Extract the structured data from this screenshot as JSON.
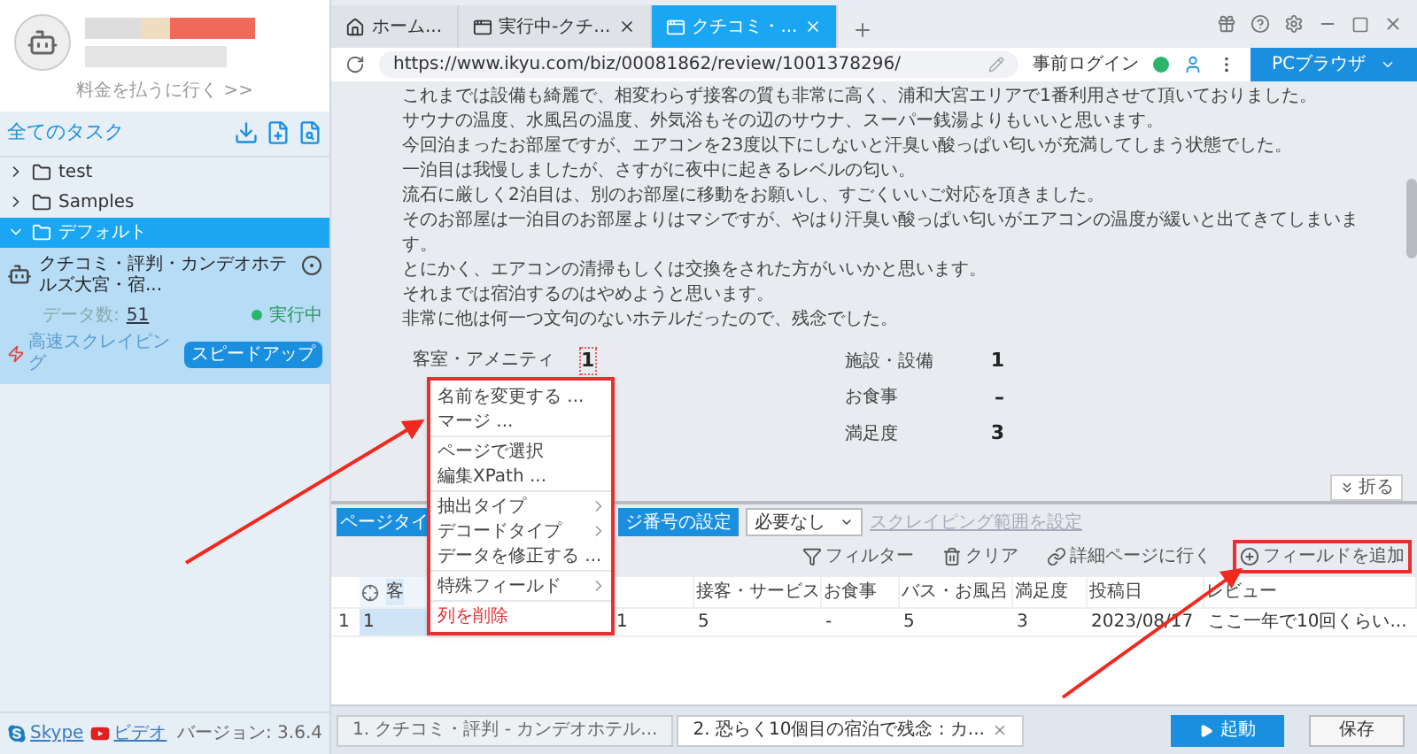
{
  "sidebar": {
    "account_link": "料金を払うに行く >>",
    "section_title": "全てのタスク",
    "folders": [
      {
        "name": "test",
        "expanded": false,
        "selected": false
      },
      {
        "name": "Samples",
        "expanded": false,
        "selected": false
      },
      {
        "name": "デフォルト",
        "expanded": true,
        "selected": true,
        "children": [
          {
            "title": "クチコミ・評判・カンデオホテルズ大宮・宿...",
            "data_label": "データ数:",
            "data_count": "51",
            "status": "実行中",
            "mode": "高速スクレイピング",
            "action": "スピードアップ"
          }
        ]
      }
    ],
    "footer": {
      "links": [
        {
          "label": "Skype",
          "kind": "skype"
        },
        {
          "label": "ビデオ",
          "kind": "video"
        }
      ],
      "version": "バージョン: 3.6.4"
    }
  },
  "browser_tabs": [
    {
      "label": "ホーム...",
      "kind": "home",
      "selected": false,
      "closable": false
    },
    {
      "label": "実行中-クチ...",
      "kind": "page",
      "selected": false,
      "closable": true
    },
    {
      "label": "クチコミ・...",
      "kind": "page",
      "selected": true,
      "closable": true
    }
  ],
  "address_bar": {
    "url": "https://www.ikyu.com/biz/00081862/review/1001378296/",
    "login": "事前ログイン",
    "browser_mode": "PCブラウザ"
  },
  "page": {
    "review_lines": [
      "これまでは設備も綺麗で、相変わらず接客の質も非常に高く、浦和大宮エリアで1番利用させて頂いておりました。",
      "サウナの温度、水風呂の温度、外気浴もその辺のサウナ、スーパー銭湯よりもいいと思います。",
      "今回泊まったお部屋ですが、エアコンを23度以下にしないと汗臭い酸っぱい匂いが充満してしまう状態でした。",
      "一泊目は我慢しましたが、さすがに夜中に起きるレベルの匂い。",
      "流石に厳しく2泊目は、別のお部屋に移動をお願いし、すごくいいご対応を頂きました。",
      "そのお部屋は一泊目のお部屋よりはマシですが、やはり汗臭い酸っぱい匂いがエアコンの温度が緩いと出てきてしまいます。",
      "とにかく、エアコンの清掃もしくは交換をされた方がいいかと思います。",
      "それまでは宿泊するのはやめようと思います。",
      "非常に他は何一つ文句のないホテルだったので、残念でした。"
    ],
    "ratings_left": [
      {
        "label": "客室・アメニティ",
        "value": "1"
      }
    ],
    "ratings_right": [
      {
        "label": "施設・設備",
        "value": "1"
      },
      {
        "label": "お食事",
        "value": "–"
      },
      {
        "label": "満足度",
        "value": "3"
      }
    ]
  },
  "context_menu": {
    "groups": [
      [
        {
          "label": "名前を変更する ...",
          "kind": "item"
        },
        {
          "label": "マージ ...",
          "kind": "item"
        }
      ],
      [
        {
          "label": "ページで選択",
          "kind": "item"
        },
        {
          "label": "編集XPath ...",
          "kind": "item"
        }
      ],
      [
        {
          "label": "抽出タイプ",
          "kind": "submenu"
        },
        {
          "label": "デコードタイプ",
          "kind": "submenu"
        },
        {
          "label": "データを修正する ...",
          "kind": "item"
        }
      ],
      [
        {
          "label": "特殊フィールド",
          "kind": "submenu"
        }
      ],
      [
        {
          "label": "列を削除",
          "kind": "danger"
        }
      ]
    ]
  },
  "collapse_button": "折る",
  "toolbar": {
    "page_type": "ページタイ",
    "page_number": "ジ番号の設定",
    "select_value": "必要なし",
    "range_link": "スクレイピング範囲を設定",
    "actions": [
      {
        "label": "フィルター",
        "kind": "filter",
        "highlighted": false
      },
      {
        "label": "クリア",
        "kind": "clear",
        "highlighted": false
      },
      {
        "label": "詳細ページに行く",
        "kind": "link",
        "highlighted": false
      },
      {
        "label": "フィールドを追加",
        "kind": "add",
        "highlighted": true
      }
    ]
  },
  "table": {
    "columns": [
      {
        "label": "客",
        "selected": true
      },
      {
        "selected": false
      },
      {
        "label": "接客・サービス",
        "selected": false
      },
      {
        "label": "お食事",
        "selected": false
      },
      {
        "label": "バス・お風呂",
        "selected": false
      },
      {
        "label": "満足度",
        "selected": false
      },
      {
        "label": "投稿日",
        "selected": false
      },
      {
        "label": "レビュー",
        "selected": false
      }
    ],
    "rows": [
      {
        "index": "1",
        "cells": [
          "1",
          "1",
          "5",
          "-",
          "5",
          "3",
          "2023/08/17",
          "ここ一年で10回くらい..."
        ]
      }
    ]
  },
  "task_tabs": [
    {
      "label": "1. クチコミ・評判 - カンデオホテル...",
      "selected": false,
      "closable": false
    },
    {
      "label": "2. 恐らく10個目の宿泊で残念 : カ...",
      "selected": true,
      "closable": true
    }
  ],
  "actions": [
    {
      "label": "起動",
      "kind": "primary"
    },
    {
      "label": "保存",
      "kind": "secondary"
    }
  ]
}
